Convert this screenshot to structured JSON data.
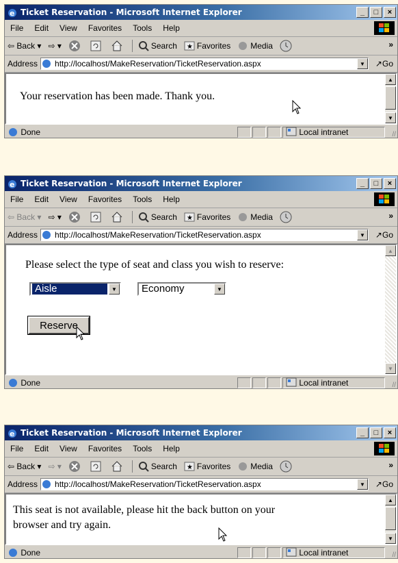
{
  "window_title": "Ticket Reservation - Microsoft Internet Explorer",
  "menu": [
    "File",
    "Edit",
    "View",
    "Favorites",
    "Tools",
    "Help"
  ],
  "toolbar": {
    "back": "Back",
    "search": "Search",
    "favorites": "Favorites",
    "media": "Media"
  },
  "address": {
    "label": "Address",
    "url": "http://localhost/MakeReservation/TicketReservation.aspx",
    "go": "Go"
  },
  "status": {
    "text": "Done",
    "zone": "Local intranet"
  },
  "screen1": {
    "message": "Your reservation has been made. Thank you."
  },
  "screen2": {
    "prompt": "Please select the type of seat and class you wish to reserve:",
    "seat_type": "Aisle",
    "seat_class": "Economy",
    "reserve_label": "Reserve"
  },
  "screen3": {
    "message_line1": "This seat is not available, please hit the back button on your",
    "message_line2": "browser and try again."
  },
  "colors": {
    "titlebar_start": "#0a246a",
    "titlebar_end": "#a6caf0",
    "chrome": "#d4d0c8",
    "background": "#fff9e6"
  }
}
